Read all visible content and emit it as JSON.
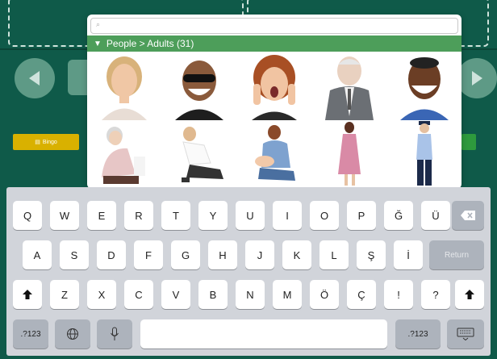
{
  "popover": {
    "search_placeholder": "",
    "header": "People > Adults (31)",
    "images": [
      "woman-portrait",
      "man-sunglasses-portrait",
      "woman-surprised-portrait",
      "elderly-man-portrait",
      "smiling-man-portrait",
      "elderly-woman-seated",
      "woman-kneeling",
      "woman-with-baby",
      "woman-pink-dress",
      "police-officer"
    ]
  },
  "app": {
    "bin_label": "Bingo"
  },
  "keyboard": {
    "row1": [
      "Q",
      "W",
      "E",
      "R",
      "T",
      "Y",
      "U",
      "I",
      "O",
      "P",
      "Ğ",
      "Ü"
    ],
    "row2": [
      "A",
      "S",
      "D",
      "F",
      "G",
      "H",
      "J",
      "K",
      "L",
      "Ş",
      "İ"
    ],
    "row2_return": "Return",
    "row3": [
      "Z",
      "X",
      "C",
      "V",
      "B",
      "N",
      "M",
      "Ö",
      "Ç",
      "!",
      "?"
    ],
    "num_left": ".?123",
    "num_right": ".?123"
  },
  "colors": {
    "app_background": "#0f5a49",
    "header_green": "#4d9e5a",
    "bin_yellow": "#d9b100"
  }
}
